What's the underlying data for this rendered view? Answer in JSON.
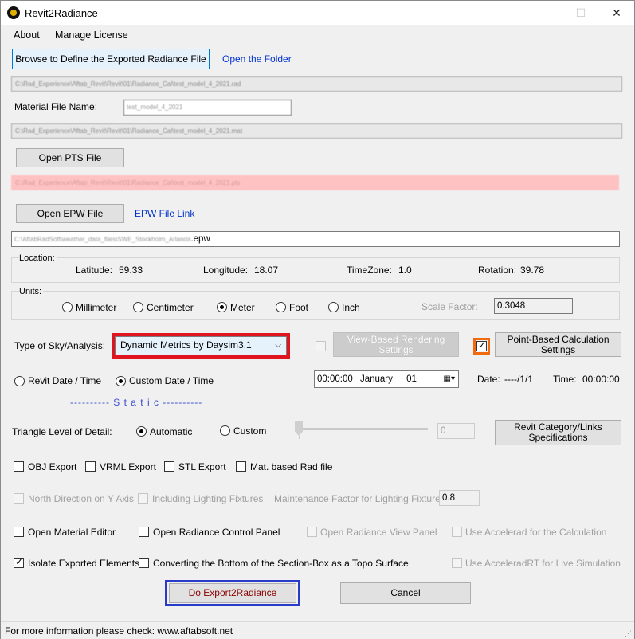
{
  "window": {
    "title": "Revit2Radiance",
    "minimize": "—",
    "maximize": "☐",
    "close": "✕"
  },
  "menu": [
    "About",
    "Manage License"
  ],
  "rad": {
    "browse_label": "Browse to Define the Exported Radiance File",
    "open_folder_label": "Open the Folder",
    "path": "C:\\Rad_Experience\\Aftab_Revit\\Revit\\01\\Radiance_Cal\\test_model_4_2021.rad"
  },
  "material": {
    "label": "Material File Name:",
    "value": "test_model_4_2021",
    "path": "C:\\Rad_Experience\\Aftab_Revit\\Revit\\01\\Radiance_Cal\\test_model_4_2021.mat"
  },
  "pts": {
    "button_label": "Open PTS File",
    "path": "C:\\Rad_Experience\\Aftab_Revit\\Revit\\01\\Radiance_Cal\\test_model_4_2021.pts"
  },
  "epw": {
    "button_label": "Open EPW File",
    "link_label": "EPW File Link",
    "path_prefix": "C:\\AftabRadSoft\\weather_data_files\\SWE_Stockholm_Arlanda",
    "path_ext": ".epw"
  },
  "location": {
    "title": "Location:",
    "latitude_label": "Latitude:",
    "latitude_value": "59.33",
    "longitude_label": "Longitude:",
    "longitude_value": "18.07",
    "timezone_label": "TimeZone:",
    "timezone_value": "1.0",
    "rotation_label": "Rotation:",
    "rotation_value": "39.78"
  },
  "units": {
    "title": "Units:",
    "options": [
      "Millimeter",
      "Centimeter",
      "Meter",
      "Foot",
      "Inch"
    ],
    "selected": "Meter",
    "scale_label": "Scale Factor:",
    "scale_value": "0.3048"
  },
  "sky": {
    "label": "Type of Sky/Analysis:",
    "selected": "Dynamic Metrics by Daysim3.1",
    "view_based_label": "View-Based Rendering Settings",
    "point_based_label": "Point-Based Calculation Settings"
  },
  "datetime": {
    "revit_label": "Revit Date / Time",
    "custom_label": "Custom Date / Time",
    "picker_time": "00:00:00",
    "picker_month": "January",
    "picker_day": "01",
    "date_label": "Date:",
    "date_value": "----/1/1",
    "time_label": "Time:",
    "time_value": "00:00:00"
  },
  "static_label": "---------- S t a t i c ----------",
  "detail": {
    "label": "Triangle Level of Detail:",
    "automatic_label": "Automatic",
    "custom_label": "Custom",
    "custom_value": "0",
    "revit_category_label": "Revit Category/Links Specifications"
  },
  "exports": {
    "obj": "OBJ Export",
    "vrml": "VRML Export",
    "stl": "STL Export",
    "mat_based": "Mat. based Rad file"
  },
  "lighting": {
    "north": "North Direction on Y Axis",
    "fixtures": "Including Lighting Fixtures",
    "maintenance_label": "Maintenance Factor for Lighting Fixtures:",
    "maintenance_value": "0.8"
  },
  "options": {
    "material_editor": "Open Material Editor",
    "control_panel": "Open Radiance Control Panel",
    "view_panel": "Open Radiance View Panel",
    "accelerad": "Use Accelerad for the Calculation",
    "isolate": "Isolate Exported Elements",
    "topo": "Converting the Bottom of the Section-Box as a Topo Surface",
    "accelerad_rt": "Use AcceleradRT for Live Simulation"
  },
  "actions": {
    "export_label": "Do Export2Radiance",
    "cancel_label": "Cancel"
  },
  "status": "For more information please check: www.aftabsoft.net",
  "colors": {
    "highlight_red": "#e0141e",
    "highlight_blue": "#2b3bc9",
    "highlight_orange": "#f06a0f",
    "pts_field_bg": "#ffc2c2",
    "link_blue": "#0033cc",
    "export_text": "#8b0000"
  }
}
